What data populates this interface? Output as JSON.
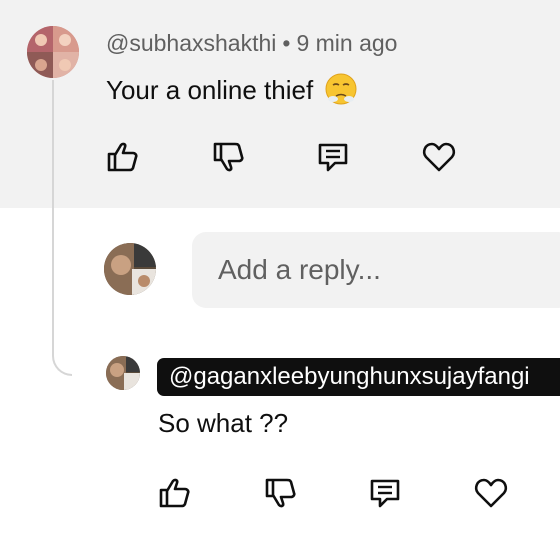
{
  "comment": {
    "author": "@subhaxshakthi",
    "separator": "•",
    "time": "9 min ago",
    "text": "Your a online thief",
    "emoji": "steam-from-nose-emoji"
  },
  "reply_input": {
    "placeholder": "Add a reply..."
  },
  "reply": {
    "mention": "@gaganxleebyunghunxsujayfangi",
    "text": "So what ??"
  },
  "actions": {
    "like": "thumbs-up-icon",
    "dislike": "thumbs-down-icon",
    "reply": "comment-icon",
    "heart": "heart-icon"
  },
  "colors": {
    "panel": "#f2f2f2",
    "mention_bg": "#0f0f0f",
    "meta_text": "#606060"
  }
}
